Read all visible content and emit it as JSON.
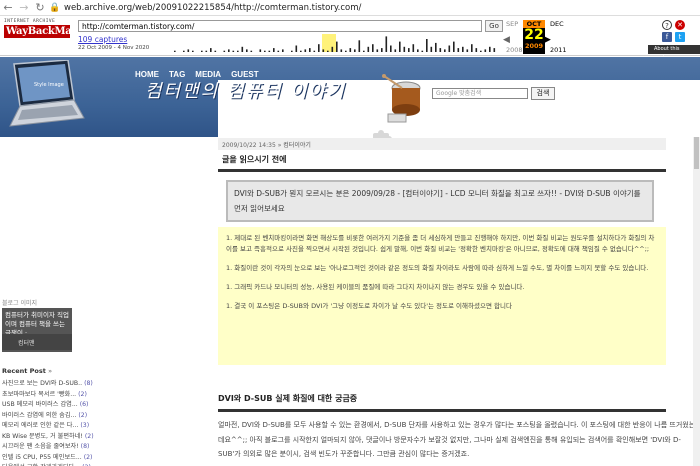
{
  "browser": {
    "url": "web.archive.org/web/20091022215854/http://comterman.tistory.com/"
  },
  "wayback": {
    "logo_top": "INTERNET ARCHIVE",
    "logo_main": "WayBackMachine",
    "url_input": "http://comterman.tistory.com/",
    "go": "Go",
    "captures": "109 captures",
    "range": "22 Oct 2009 - 4 Nov 2020",
    "prev_month": "SEP",
    "cur_month": "OCT",
    "next_month": "DEC",
    "cur_day": "22",
    "prev_year": "2008",
    "cur_year": "2009",
    "next_year": "2011",
    "about": "About this capture"
  },
  "blog": {
    "nav": [
      "HOME",
      "TAG",
      "MEDIA",
      "GUEST"
    ],
    "title": "컴터맨의 컴퓨터 이야기",
    "laptop_label": "Style Image",
    "search_placeholder": "Google 맞춤검색",
    "search_button": "검색",
    "meta_date": "2009/10/22 14:35",
    "meta_cat": "컴터이야기"
  },
  "sidebar": {
    "image_alt": "블로그 이미지",
    "promo_text": "컴퓨터가 취미이자 직업이며 컴퓨터 책을 쓰는 글쟁이 ·",
    "promo_foot": "컴터맨",
    "recent_title": "Recent Post",
    "recent_dots": "»",
    "recent": [
      {
        "t": "사진으로 보는 DVI와 D-SUB..",
        "c": "(8)"
      },
      {
        "t": "초보마마보다 목서르 '빵화...",
        "c": "(2)"
      },
      {
        "t": "USB 메모리 바이러스 감염...",
        "c": "(6)"
      },
      {
        "t": "바이러스 감염에 의한 숨김...",
        "c": "(2)"
      },
      {
        "t": "메모리 에러로 인한 같은 다...",
        "c": "(3)"
      },
      {
        "t": "KB Wise 문병도, 거 불편하네!",
        "c": "(2)"
      },
      {
        "t": "시끄러운 팬 소음을 줄여보자!",
        "c": "(8)"
      },
      {
        "t": "인텔 i5 CPU, P55 메인보드...",
        "c": "(2)"
      },
      {
        "t": "다음에서 교환 갈게가게되다...",
        "c": "(2)"
      }
    ]
  },
  "content": {
    "section1_title": "글을 읽으시기 전에",
    "notice": "DVI와 D-SUB가 뭔지 모르시는 분은 2009/09/28 - [컴터이야기] - LCD 모니터 화질을 최고로 쓰자!! - DVI와 D-SUB 이야기를 먼저 읽어보세요",
    "points": [
      "1. 제대로 된 벤치마킹이라면 화면 해상도를 비롯한 여러가지 기준을 좀 더 세심하게 만들고 진행해야 하지만, 이번 화질 비교는 원도우를 설치하다가 화질의 차이를 보고 즉흥적으로 사진을 찍으면서 시작된 것입니다. 쉽게 말해, 이번 화질 비교는 '정확한 벤치마킹'은 아니므로, 정확도에 대해 책임질 수 없습니다^^;;",
      "1. 화질이란 것이 각자의 눈으로 보는 '아나로그적인 것이라 같은 정도의 화질 차이라도 사람에 따라 심하게 느낄 수도, 별 차이를 느끼지 못할 수도 있습니다.",
      "1. 그래픽 카드나 모니터의 성능, 사용된 케이블의 품질에 따라 그다지 차이나지 않는 경우도 있을 수 있습니다.",
      "1. 결국 이 포스팅은 D-SUB와 DVI가 '그냥 이정도로 차이가 날 수도 있다'는 정도로 이해하셨으면 합니다"
    ],
    "section2_title": "DVI와 D-SUB 실제 화질에 대한 궁금증",
    "body": "얼마전, DVI와 D-SUB를 모두 사용할 수 있는 환경에서, D-SUB 단자를 사용하고 있는 경우가 많다는 포스팅을 올렸습니다. 이 포스팅에 대한 반응이 나름 뜨거웠는데요^^;; 아직 블로그를 시작한지 얼마되지 않아, 댓글이나 방문자수가 보잘것 없지만, 그나마 실제 검색엔진을 통해 유입되는 검색어를 확인해보면 'DVI와 D-SUB'가 의외로 많은 분이시, 검색 빈도가 꾸준합니다. 그만큼 관심이 많다는 증거겠죠."
  },
  "colors": {
    "header_blue": "#3c6396",
    "notice_yellow": "#ffffc8",
    "wayback_red": "#b00000",
    "oct_orange": "#ff8800"
  }
}
